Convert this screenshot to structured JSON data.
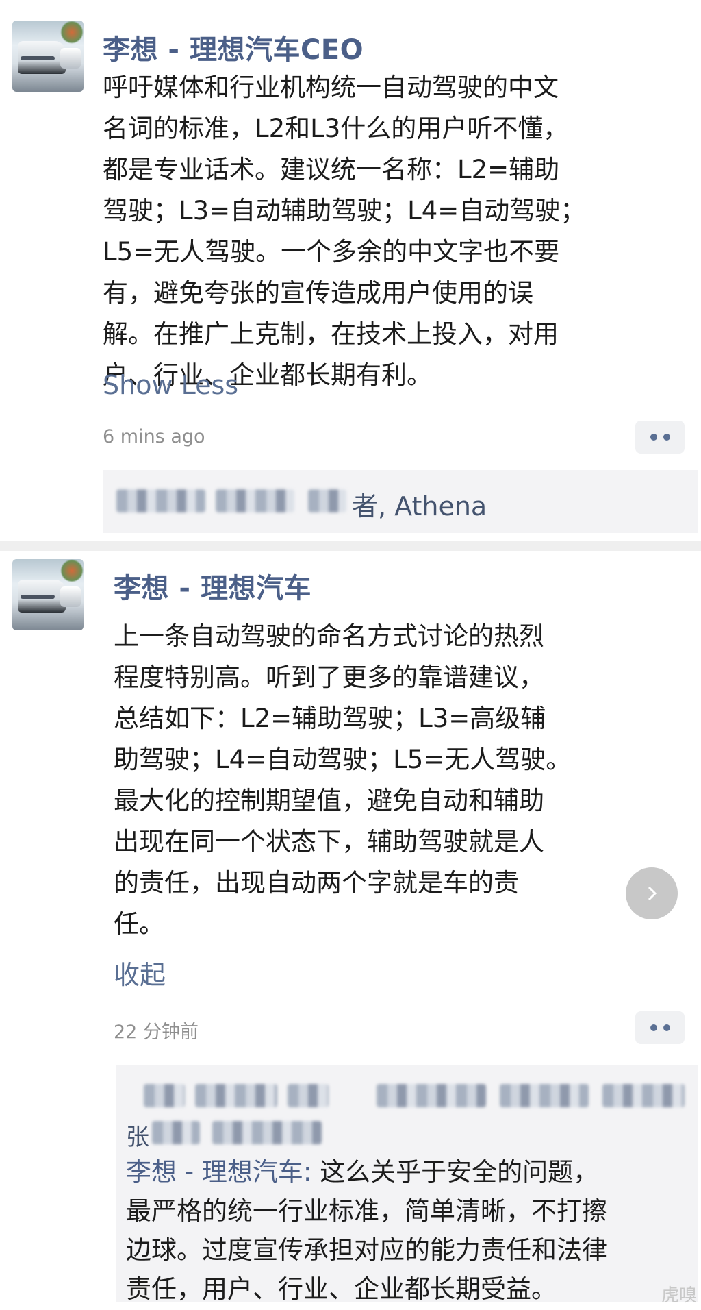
{
  "post1": {
    "author": "李想 - 理想汽车CEO",
    "lines": [
      "呼吁媒体和行业机构统一自动驾驶的中文",
      "名词的标准，L2和L3什么的用户听不懂，",
      "都是专业话术。建议统一名称：L2=辅助",
      "驾驶；L3=自动辅助驾驶；L4=自动驾驶；",
      "L5=无人驾驶。一个多余的中文字也不要",
      "有，避免夸张的宣传造成用户使用的误",
      "解。在推广上克制，在技术上投入，对用",
      "户、行业、企业都长期有利。"
    ],
    "toggle_label": "Show Less",
    "timestamp": "6 mins ago",
    "likes_visible": "者, Athena"
  },
  "post2": {
    "author": "李想 - 理想汽车",
    "lines": [
      "上一条自动驾驶的命名方式讨论的热烈",
      "程度特别高。听到了更多的靠谱建议，",
      "总结如下：L2=辅助驾驶；L3=高级辅",
      "助驾驶；L4=自动驾驶；L5=无人驾驶。",
      "最大化的控制期望值，避免自动和辅助",
      "出现在同一个状态下，辅助驾驶就是人",
      "的责任，出现自动两个字就是车的责",
      "任。"
    ],
    "toggle_label": "收起",
    "timestamp": "22 分钟前",
    "likes_partial": "张",
    "reply": {
      "author": "李想 - 理想汽车",
      "separator": ": ",
      "first_line_text": "这么关乎于安全的问题，",
      "lines": [
        "最严格的统一行业标准，简单清晰，不打擦",
        "边球。过度宣传承担对应的能力责任和法律",
        "责任，用户、行业、企业都长期受益。"
      ]
    }
  },
  "watermark": "虎嗅",
  "colors": {
    "link": "#4b5f88",
    "background": "#ffffff",
    "divider": "#efefef"
  }
}
